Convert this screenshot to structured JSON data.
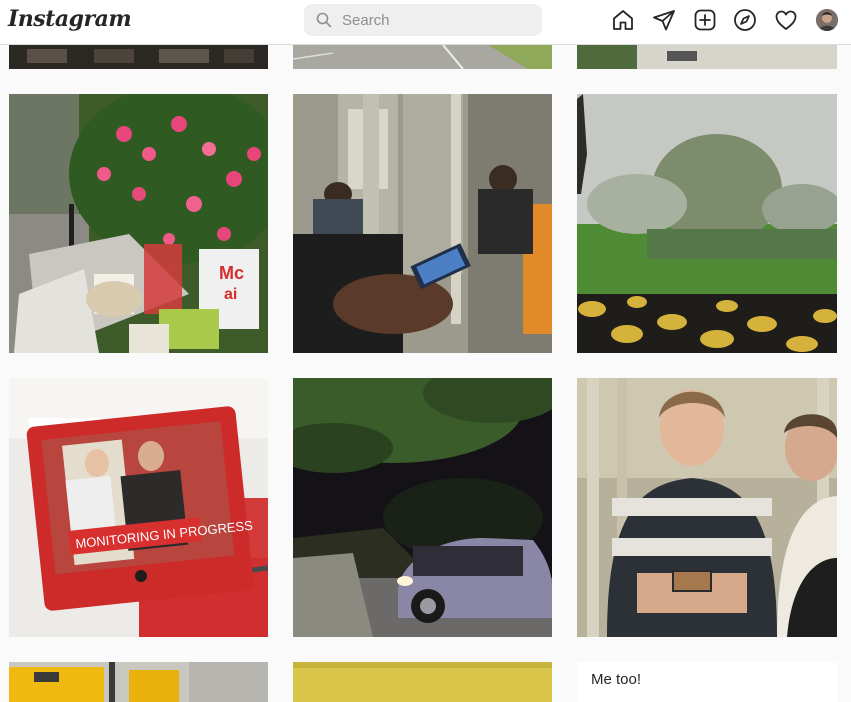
{
  "header": {
    "logo": "Instagram",
    "search_placeholder": "Search"
  },
  "icons": [
    "home-icon",
    "direct-icon",
    "new-post-icon",
    "explore-icon",
    "activity-icon"
  ],
  "grid": {
    "posts": [
      {
        "subject": "flower-bush-and-trash"
      },
      {
        "subject": "subway-riders-phones"
      },
      {
        "subject": "foggy-park"
      },
      {
        "subject": "monitor-screen"
      },
      {
        "subject": "car-at-night"
      },
      {
        "subject": "man-on-subway-phone"
      }
    ],
    "monitor_caption": "MONITORING IN PROGRESS",
    "cup_text": "Mc\nai",
    "comment": "Me too!"
  },
  "colors": {
    "background": "#fafafa",
    "header": "#ffffff",
    "border": "#dbdbdb",
    "search_bg": "#efefef",
    "monitor_red": "#d92b2b"
  }
}
